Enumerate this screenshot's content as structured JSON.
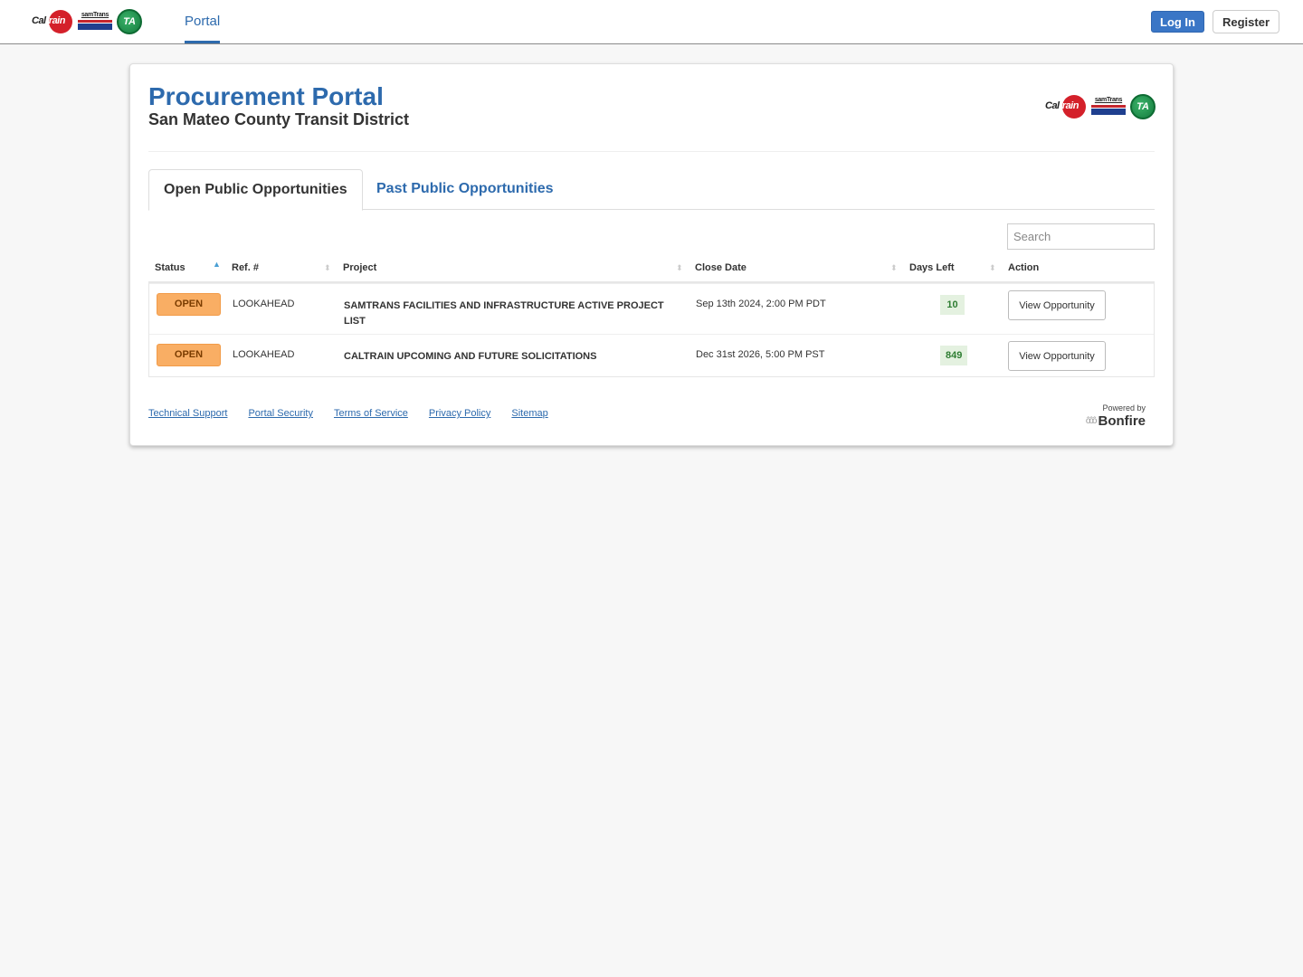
{
  "navbar": {
    "logos": {
      "caltrain": {
        "prefix": "Cal",
        "suffix": "train"
      },
      "samtrans": "samTrans",
      "ta": "TA"
    },
    "tab": "Portal",
    "login_label": "Log In",
    "register_label": "Register"
  },
  "header": {
    "title": "Procurement Portal",
    "subtitle": "San Mateo County Transit District"
  },
  "tabs": [
    {
      "label": "Open Public Opportunities",
      "active": true
    },
    {
      "label": "Past Public Opportunities",
      "active": false
    }
  ],
  "search": {
    "placeholder": "Search",
    "value": ""
  },
  "table": {
    "columns": [
      {
        "label": "Status",
        "sort": "ascending"
      },
      {
        "label": "Ref. #",
        "sort": "none"
      },
      {
        "label": "Project",
        "sort": "none"
      },
      {
        "label": "Close Date",
        "sort": "none"
      },
      {
        "label": "Days Left",
        "sort": "none"
      },
      {
        "label": "Action",
        "sort": "none"
      }
    ],
    "rows": [
      {
        "status": "OPEN",
        "ref": "LOOKAHEAD",
        "project": "SAMTRANS FACILITIES AND INFRASTRUCTURE ACTIVE PROJECT LIST",
        "close_date": "Sep 13th 2024, 2:00 PM PDT",
        "days_left": "10",
        "action": "View Opportunity"
      },
      {
        "status": "OPEN",
        "ref": "LOOKAHEAD",
        "project": "CALTRAIN UPCOMING AND FUTURE SOLICITATIONS",
        "close_date": "Dec 31st 2026, 5:00 PM PST",
        "days_left": "849",
        "action": "View Opportunity"
      }
    ]
  },
  "footer": {
    "links": [
      "Technical Support",
      "Portal Security",
      "Terms of Service",
      "Privacy Policy",
      "Sitemap"
    ],
    "powered_by": "Powered by",
    "brand": "Bonfire"
  },
  "colors": {
    "accent": "#2d6aad",
    "login_button": "#3a76c6",
    "status_open": "#f9ae64",
    "days_left_bg": "#e4f1e0",
    "days_left_text": "#2e7d32"
  }
}
